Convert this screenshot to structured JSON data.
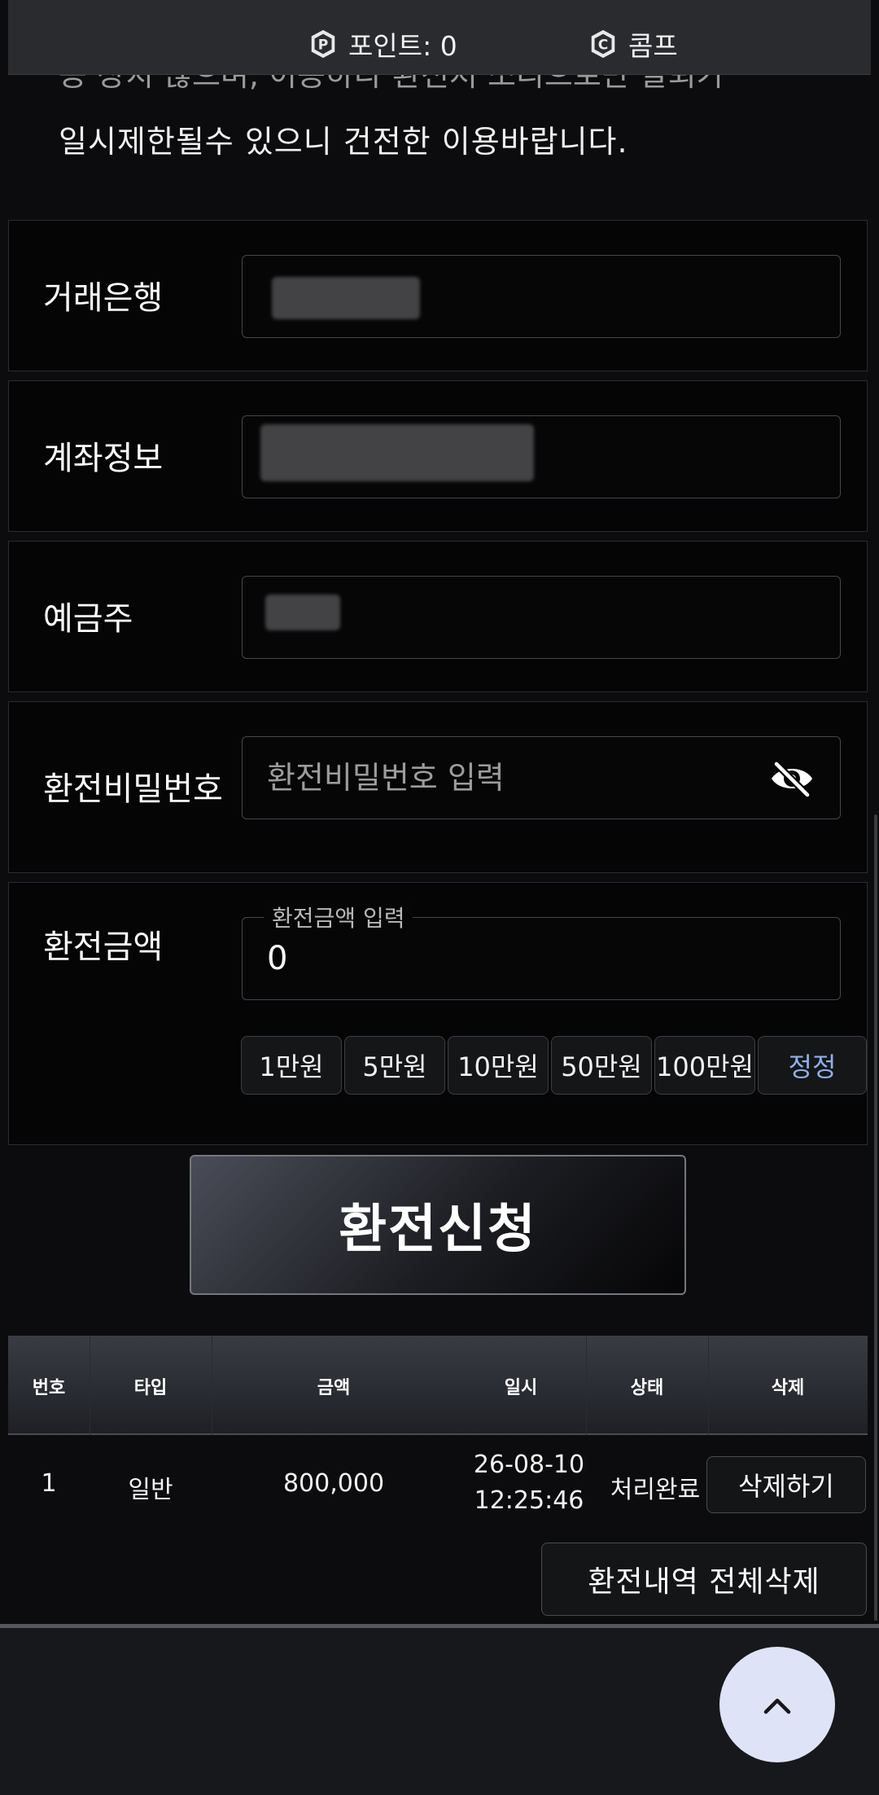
{
  "topbar": {
    "points_label": "포인트: 0",
    "comp_label": "콤프"
  },
  "notice": {
    "line_cut": "등 장치 않으며, 이용하다 환전처 소리으로만 탈퇴가",
    "line": "일시제한될수 있으니 건전한 이용바랍니다."
  },
  "form": {
    "bank_label": "거래은행",
    "account_label": "계좌정보",
    "holder_label": "예금주",
    "password_label": "환전비밀번호",
    "password_placeholder": "환전비밀번호 입력",
    "amount_label": "환전금액",
    "amount_float_label": "환전금액 입력",
    "amount_value": "0",
    "quick_amounts": [
      "1만원",
      "5만원",
      "10만원",
      "50만원",
      "100만원"
    ],
    "reset_label": "정정",
    "submit_label": "환전신청"
  },
  "table": {
    "headers": [
      "번호",
      "타입",
      "금액",
      "일시",
      "상태",
      "삭제"
    ],
    "rows": [
      {
        "no": "1",
        "type": "일반",
        "amount": "800,000",
        "date": "26-08-10",
        "time": "12:25:46",
        "status": "처리완료",
        "delete_label": "삭제하기"
      }
    ],
    "delete_all_label": "환전내역 전체삭제"
  },
  "colors": {
    "accent_reset": "#8fb0e8",
    "scroll_top_bg": "#dfe3f7"
  }
}
